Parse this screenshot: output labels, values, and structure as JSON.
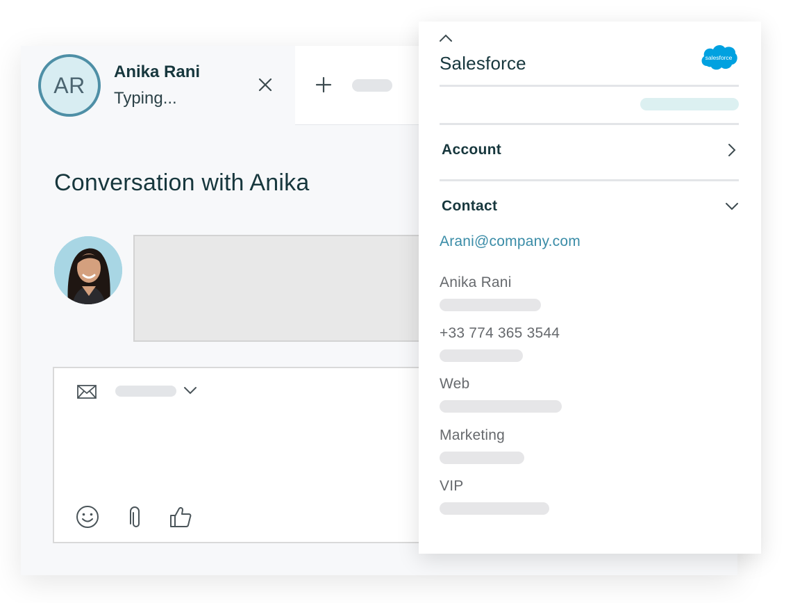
{
  "conversation_tab": {
    "initials": "AR",
    "name": "Anika Rani",
    "status": "Typing..."
  },
  "main": {
    "title": "Conversation with Anika"
  },
  "composer": {
    "channel_icon": "envelope-icon",
    "tools": [
      "smiley-icon",
      "paperclip-icon",
      "thumbs-up-icon"
    ]
  },
  "salesforce_panel": {
    "title": "Salesforce",
    "logo_text": "salesforce",
    "sections": [
      {
        "label": "Account",
        "state": "collapsed"
      },
      {
        "label": "Contact",
        "state": "expanded"
      }
    ],
    "contact": {
      "email": "Arani@company.com",
      "fields": [
        "Anika Rani",
        "+33 774 365 3544",
        "Web",
        "Marketing",
        "VIP"
      ]
    }
  },
  "colors": {
    "accent": "#4e8fa6",
    "link": "#3a8ca7",
    "heading": "#17373d",
    "salesforce_blue": "#00a1e0"
  }
}
